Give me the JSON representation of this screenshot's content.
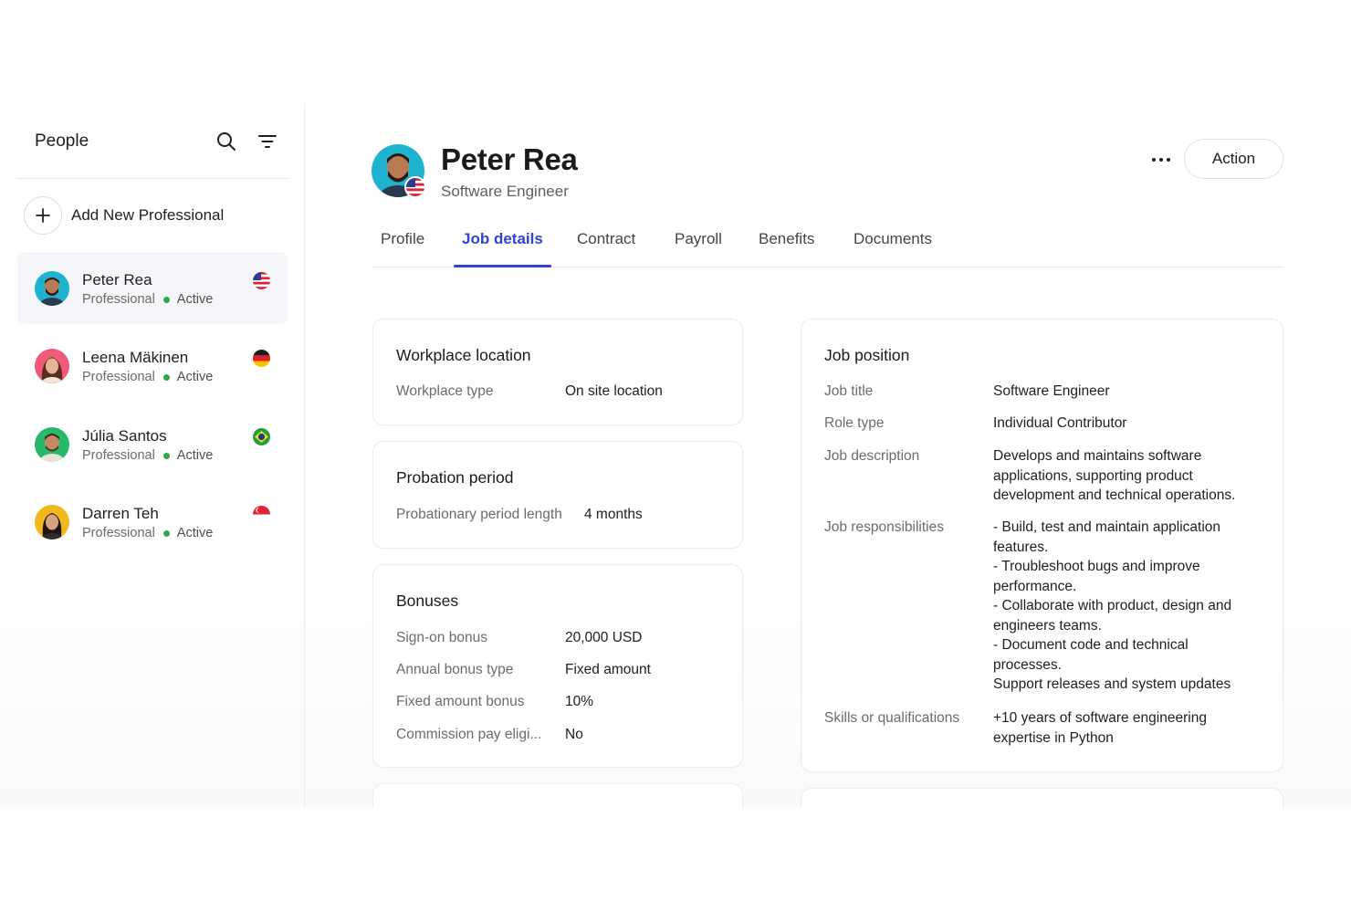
{
  "sidebar": {
    "title": "People",
    "search_icon": "search-icon",
    "filter_icon": "filter-icon",
    "add_label": "Add New Professional",
    "people": [
      {
        "name": "Peter Rea",
        "role": "Professional",
        "status": "Active",
        "flag": "us",
        "selected": true
      },
      {
        "name": "Leena Mäkinen",
        "role": "Professional",
        "status": "Active",
        "flag": "de",
        "selected": false
      },
      {
        "name": "Júlia Santos",
        "role": "Professional",
        "status": "Active",
        "flag": "br",
        "selected": false
      },
      {
        "name": "Darren Teh",
        "role": "Professional",
        "status": "Active",
        "flag": "sg",
        "selected": false
      }
    ]
  },
  "header": {
    "name": "Peter Rea",
    "role": "Software Engineer",
    "action_label": "Action"
  },
  "tabs": [
    {
      "label": "Profile",
      "active": false
    },
    {
      "label": "Job details",
      "active": true
    },
    {
      "label": "Contract",
      "active": false
    },
    {
      "label": "Payroll",
      "active": false
    },
    {
      "label": "Benefits",
      "active": false
    },
    {
      "label": "Documents",
      "active": false
    }
  ],
  "workplace": {
    "title": "Workplace location",
    "type_label": "Workplace type",
    "type_value": "On site location"
  },
  "probation": {
    "title": "Probation period",
    "length_label": "Probationary period length",
    "length_value": "4 months"
  },
  "bonuses": {
    "title": "Bonuses",
    "rows": [
      {
        "label": "Sign-on bonus",
        "value": "20,000 USD"
      },
      {
        "label": "Annual bonus type",
        "value": "Fixed amount"
      },
      {
        "label": "Fixed amount bonus",
        "value": "10%"
      },
      {
        "label": "Commission pay eligi...",
        "value": "No"
      }
    ]
  },
  "job_position": {
    "title": "Job position",
    "job_title_label": "Job title",
    "job_title_value": "Software Engineer",
    "role_type_label": "Role type",
    "role_type_value": "Individual Contributor",
    "description_label": "Job description",
    "description_value": "Develops and maintains software applications, supporting product development and technical operations.",
    "responsibilities_label": "Job responsibilities",
    "responsibilities_value": "- Build, test and maintain application features.\n- Troubleshoot bugs and improve performance.\n- Collaborate with product, design and engineers teams.\n- Document code and technical processes.\nSupport releases and system updates",
    "skills_label": "Skills or qualifications",
    "skills_value": "+10 years of software engineering expertise in Python"
  },
  "colors": {
    "accent": "#2d44d6",
    "status_active": "#2fa84f"
  }
}
